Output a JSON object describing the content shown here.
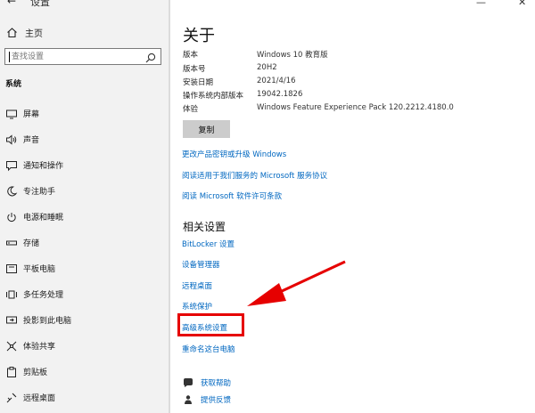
{
  "window": {
    "back_glyph": "←",
    "title": "设置",
    "min_glyph": "—",
    "close_glyph": "✕"
  },
  "sidebar": {
    "home_label": "主页",
    "search_placeholder": "查找设置",
    "section_label": "系统",
    "items": [
      {
        "label": "屏幕",
        "icon": "monitor-icon"
      },
      {
        "label": "声音",
        "icon": "speaker-icon"
      },
      {
        "label": "通知和操作",
        "icon": "notification-icon"
      },
      {
        "label": "专注助手",
        "icon": "moon-icon"
      },
      {
        "label": "电源和睡眠",
        "icon": "power-icon"
      },
      {
        "label": "存储",
        "icon": "storage-icon"
      },
      {
        "label": "平板电脑",
        "icon": "tablet-icon"
      },
      {
        "label": "多任务处理",
        "icon": "multitask-icon"
      },
      {
        "label": "投影到此电脑",
        "icon": "project-icon"
      },
      {
        "label": "体验共享",
        "icon": "share-icon"
      },
      {
        "label": "剪贴板",
        "icon": "clipboard-icon"
      },
      {
        "label": "远程桌面",
        "icon": "remote-icon"
      }
    ]
  },
  "main": {
    "title": "关于",
    "specs": [
      {
        "key": "版本",
        "value": "Windows 10 教育版"
      },
      {
        "key": "版本号",
        "value": "20H2"
      },
      {
        "key": "安装日期",
        "value": "2021/4/16"
      },
      {
        "key": "操作系统内部版本",
        "value": "19042.1826"
      },
      {
        "key": "体验",
        "value": "Windows Feature Experience Pack 120.2212.4180.0"
      }
    ],
    "copy_label": "复制",
    "links": [
      "更改产品密钥或升级 Windows",
      "阅读适用于我们服务的 Microsoft 服务协议",
      "阅读 Microsoft 软件许可条款"
    ],
    "related_title": "相关设置",
    "related_links": [
      "BitLocker 设置",
      "设备管理器",
      "远程桌面",
      "系统保护",
      "高级系统设置",
      "重命名这台电脑"
    ],
    "help_label": "获取帮助",
    "feedback_label": "提供反馈"
  },
  "colors": {
    "link": "#0067c0",
    "highlight": "#e60000",
    "sidebar_bg": "#f2f2f2"
  }
}
